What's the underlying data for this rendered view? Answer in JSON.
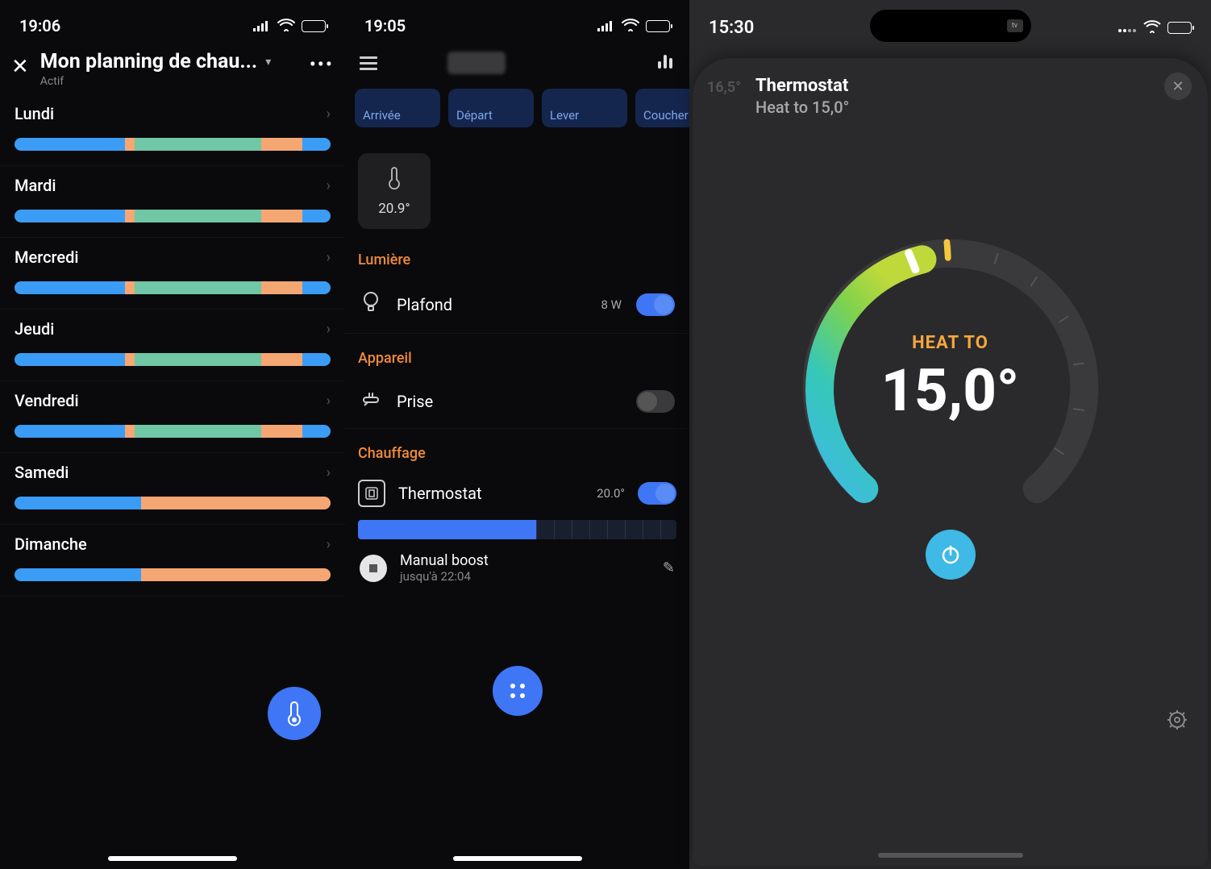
{
  "phone1": {
    "status": {
      "time": "19:06",
      "batteryPct": 85
    },
    "header": {
      "title": "Mon planning de chau...",
      "subtitle": "Actif"
    },
    "days": [
      {
        "name": "Lundi",
        "segs": [
          [
            "blue",
            35
          ],
          [
            "orange",
            3
          ],
          [
            "green",
            40
          ],
          [
            "orange",
            13
          ],
          [
            "blue",
            9
          ]
        ]
      },
      {
        "name": "Mardi",
        "segs": [
          [
            "blue",
            35
          ],
          [
            "orange",
            3
          ],
          [
            "green",
            40
          ],
          [
            "orange",
            13
          ],
          [
            "blue",
            9
          ]
        ]
      },
      {
        "name": "Mercredi",
        "segs": [
          [
            "blue",
            35
          ],
          [
            "orange",
            3
          ],
          [
            "green",
            40
          ],
          [
            "orange",
            13
          ],
          [
            "blue",
            9
          ]
        ]
      },
      {
        "name": "Jeudi",
        "segs": [
          [
            "blue",
            35
          ],
          [
            "orange",
            3
          ],
          [
            "green",
            40
          ],
          [
            "orange",
            13
          ],
          [
            "blue",
            9
          ]
        ]
      },
      {
        "name": "Vendredi",
        "segs": [
          [
            "blue",
            35
          ],
          [
            "orange",
            3
          ],
          [
            "green",
            40
          ],
          [
            "orange",
            13
          ],
          [
            "blue",
            9
          ]
        ]
      },
      {
        "name": "Samedi",
        "segs": [
          [
            "blue",
            40
          ],
          [
            "orange",
            60
          ]
        ]
      },
      {
        "name": "Dimanche",
        "segs": [
          [
            "blue",
            40
          ],
          [
            "orange",
            60
          ]
        ]
      }
    ]
  },
  "phone2": {
    "status": {
      "time": "19:05",
      "batteryPct": 85
    },
    "chips": [
      "Arrivée",
      "Départ",
      "Lever",
      "Coucher"
    ],
    "tempTile": "20.9°",
    "sections": {
      "light": {
        "heading": "Lumière",
        "device": "Plafond",
        "meta": "8 W",
        "on": true
      },
      "appliance": {
        "heading": "Appareil",
        "device": "Prise",
        "on": false
      },
      "heating": {
        "heading": "Chauffage",
        "device": "Thermostat",
        "meta": "20.0°",
        "on": true,
        "sliderPct": 56,
        "boost": {
          "title": "Manual boost",
          "subtitle": "jusqu'à 22:04"
        }
      }
    }
  },
  "phone3": {
    "status": {
      "time": "15:30",
      "batteryPct": 70
    },
    "dimCurrent": "16,5°",
    "title": "Thermostat",
    "subtitle": "Heat to 15,0°",
    "dial": {
      "label": "HEAT TO",
      "value": "15,0°",
      "setpointAngleDeg": 250,
      "currentAngleDeg": 263,
      "gradientStops": [
        [
          "#3fb9e5",
          0
        ],
        [
          "#36c8b8",
          35
        ],
        [
          "#7fd24d",
          70
        ],
        [
          "#c0d93a",
          100
        ]
      ]
    }
  }
}
